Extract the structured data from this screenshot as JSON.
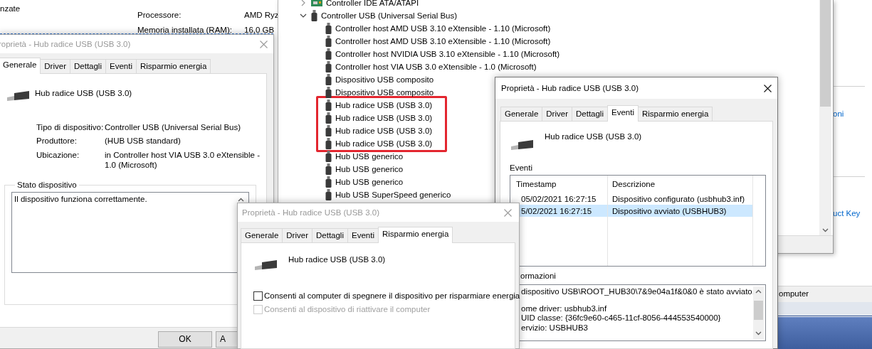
{
  "background_window": {
    "heading_fragment": "nzate",
    "specs": [
      {
        "label": "Processore:",
        "value": "AMD Ryz"
      },
      {
        "label": "Memoria installata (RAM):",
        "value": "16,0 GB"
      }
    ],
    "links": [
      "oni",
      "uct Key"
    ],
    "status_bar": "omputer"
  },
  "device_manager": {
    "tree": [
      {
        "label": "Controller IDE ATA/ATAPI",
        "kind": "board",
        "expanded": false
      },
      {
        "label": "Controller USB (Universal Serial Bus)",
        "kind": "plug",
        "expanded": true,
        "children": [
          {
            "label": "Controller host AMD USB 3.10 eXtensible - 1.10 (Microsoft)",
            "highlighted": false
          },
          {
            "label": "Controller host AMD USB 3.10 eXtensible - 1.10 (Microsoft)",
            "highlighted": false
          },
          {
            "label": "Controller host NVIDIA USB 3.10 eXtensible - 1.10 (Microsoft)",
            "highlighted": false
          },
          {
            "label": "Controller host VIA USB 3.0 eXtensible - 1.0 (Microsoft)",
            "highlighted": false
          },
          {
            "label": "Dispositivo USB composito",
            "highlighted": false
          },
          {
            "label": "Dispositivo USB composito",
            "highlighted": false
          },
          {
            "label": "Hub radice USB (USB 3.0)",
            "highlighted": true
          },
          {
            "label": "Hub radice USB (USB 3.0)",
            "highlighted": true
          },
          {
            "label": "Hub radice USB (USB 3.0)",
            "highlighted": true
          },
          {
            "label": "Hub radice USB (USB 3.0)",
            "highlighted": true
          },
          {
            "label": "Hub USB generico",
            "highlighted": false
          },
          {
            "label": "Hub USB generico",
            "highlighted": false
          },
          {
            "label": "Hub USB generico",
            "highlighted": false
          },
          {
            "label": "Hub USB SuperSpeed generico",
            "highlighted": false
          }
        ]
      }
    ]
  },
  "general_dialog": {
    "title": "roprietà - Hub radice USB (USB 3.0)",
    "active": false,
    "tabs": [
      {
        "label": "Generale",
        "selected": true
      },
      {
        "label": "Driver",
        "selected": false
      },
      {
        "label": "Dettagli",
        "selected": false
      },
      {
        "label": "Eventi",
        "selected": false
      },
      {
        "label": "Risparmio energia",
        "selected": false
      }
    ],
    "device_name": "Hub radice USB (USB 3.0)",
    "properties": [
      {
        "label": "Tipo di dispositivo:",
        "value": "Controller USB (Universal Serial Bus)"
      },
      {
        "label": "Produttore:",
        "value": "(HUB USB standard)"
      },
      {
        "label": "Ubicazione:",
        "value": "in Controller host VIA USB 3.0 eXtensible - 1.0 (Microsoft)"
      }
    ],
    "status_group": "Stato dispositivo",
    "status_text": "Il dispositivo funziona correttamente.",
    "buttons": [
      "OK",
      "A"
    ]
  },
  "events_dialog": {
    "title": "Proprietà - Hub radice USB (USB 3.0)",
    "active": true,
    "tabs": [
      {
        "label": "Generale",
        "selected": false
      },
      {
        "label": "Driver",
        "selected": false
      },
      {
        "label": "Dettagli",
        "selected": false
      },
      {
        "label": "Eventi",
        "selected": true
      },
      {
        "label": "Risparmio energia",
        "selected": false
      }
    ],
    "device_name": "Hub radice USB (USB 3.0)",
    "events_label": "Eventi",
    "columns": [
      "Timestamp",
      "Descrizione"
    ],
    "rows": [
      {
        "cells": [
          "05/02/2021 16:27:15",
          "Dispositivo configurato (usbhub3.inf)"
        ],
        "selected": false
      },
      {
        "cells": [
          "5/02/2021 16:27:15",
          "Dispositivo avviato (USBHUB3)"
        ],
        "selected": true
      }
    ],
    "info_label": "ormazioni",
    "info_lines": [
      "dispositivo USB\\ROOT_HUB30\\7&9e04a1f&0&0 è stato avviato.",
      "ome driver: usbhub3.inf",
      "UID classe: {36fc9e60-c465-11cf-8056-444553540000}",
      "ervizio: USBHUB3"
    ]
  },
  "power_dialog": {
    "title": "Proprietà - Hub radice USB (USB 3.0)",
    "active": false,
    "tabs": [
      {
        "label": "Generale",
        "selected": false
      },
      {
        "label": "Driver",
        "selected": false
      },
      {
        "label": "Dettagli",
        "selected": false
      },
      {
        "label": "Eventi",
        "selected": false
      },
      {
        "label": "Risparmio energia",
        "selected": true
      }
    ],
    "device_name": "Hub radice USB (USB 3.0)",
    "options": [
      {
        "label": "Consenti al computer di spegnere il dispositivo per risparmiare energia",
        "checked": false,
        "disabled": false
      },
      {
        "label": "Consenti al dispositivo di riattivare il computer",
        "checked": false,
        "disabled": true
      }
    ]
  }
}
